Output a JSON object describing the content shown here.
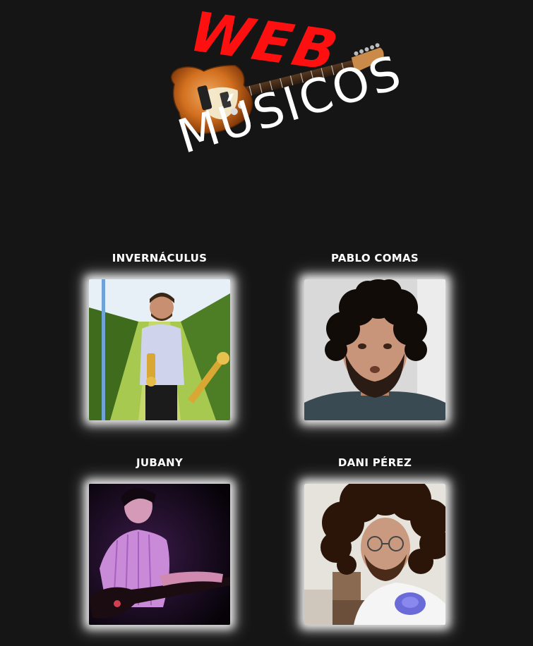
{
  "header": {
    "logo_top": "WEB",
    "logo_bottom": "MÚSICOS"
  },
  "musicians": [
    {
      "name": "INVERNÁCULUS"
    },
    {
      "name": "PABLO COMAS"
    },
    {
      "name": "JUBANY"
    },
    {
      "name": "DANI PÉREZ"
    }
  ],
  "colors": {
    "background": "#151515",
    "logo_red": "#ff1010",
    "text": "#ffffff"
  }
}
